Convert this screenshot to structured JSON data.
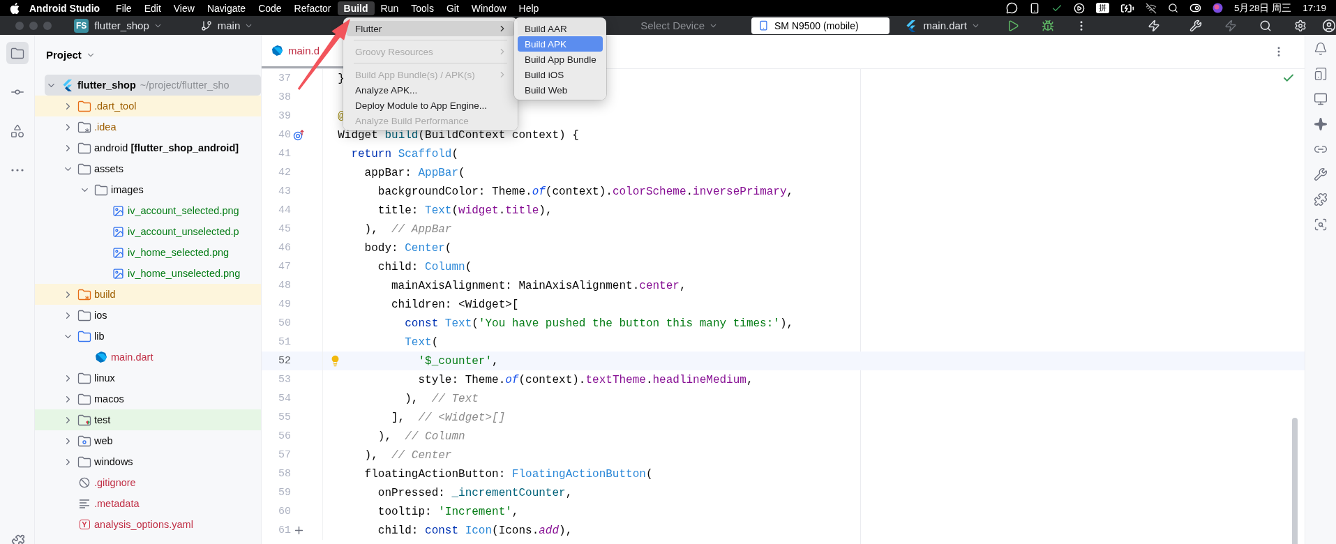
{
  "menu_bar": {
    "app_name": "Android Studio",
    "items": [
      {
        "label": "File",
        "selected": false
      },
      {
        "label": "Edit",
        "selected": false
      },
      {
        "label": "View",
        "selected": false
      },
      {
        "label": "Navigate",
        "selected": false
      },
      {
        "label": "Code",
        "selected": false
      },
      {
        "label": "Refactor",
        "selected": false
      },
      {
        "label": "Build",
        "selected": true
      },
      {
        "label": "Run",
        "selected": false
      },
      {
        "label": "Tools",
        "selected": false
      },
      {
        "label": "Git",
        "selected": false
      },
      {
        "label": "Window",
        "selected": false
      },
      {
        "label": "Help",
        "selected": false
      }
    ],
    "input_method": "拼",
    "date": "5月28日 周三",
    "time": "17:19"
  },
  "toolbar": {
    "project_badge": "FS",
    "project": "flutter_shop",
    "branch": "main",
    "device_selector": "Select Device",
    "device": "SM N9500 (mobile)",
    "run_config": "main.dart"
  },
  "left_strip": [
    {
      "kind": "project",
      "selected": true
    },
    {
      "kind": "commit",
      "selected": false
    },
    {
      "kind": "structure",
      "selected": false
    },
    {
      "kind": "more",
      "selected": false
    }
  ],
  "project_panel": {
    "title": "Project",
    "tree": [
      {
        "name": "flutter_shop",
        "hint": "~/project/flutter_sho",
        "kind": "flutter",
        "color": "#080808",
        "selected": true,
        "expanded": true,
        "children": [
          {
            "name": ".dart_tool",
            "kind": "excluded-folder",
            "color": "#9e5e00",
            "selected": false,
            "expanded": false
          },
          {
            "name": ".idea",
            "kind": "config-folder",
            "color": "#9e5e00",
            "selected": false,
            "expanded": false
          },
          {
            "name": "android **[flutter_shop_android]**",
            "kind": "folder",
            "color": "#080808",
            "selected": false,
            "expanded": false
          },
          {
            "name": "assets",
            "kind": "folder",
            "color": "#080808",
            "selected": false,
            "expanded": true,
            "children": [
              {
                "name": "images",
                "kind": "folder",
                "color": "#080808",
                "selected": false,
                "expanded": true,
                "children": [
                  {
                    "name": "iv_account_selected.png",
                    "kind": "image",
                    "color": "#067d17",
                    "selected": false
                  },
                  {
                    "name": "iv_account_unselected.p",
                    "kind": "image",
                    "color": "#067d17",
                    "selected": false
                  },
                  {
                    "name": "iv_home_selected.png",
                    "kind": "image",
                    "color": "#067d17",
                    "selected": false
                  },
                  {
                    "name": "iv_home_unselected.png",
                    "kind": "image",
                    "color": "#067d17",
                    "selected": false
                  }
                ]
              }
            ]
          },
          {
            "name": "build",
            "kind": "excluded-config-folder",
            "color": "#9e5e00",
            "selected": false,
            "expanded": false
          },
          {
            "name": "ios",
            "kind": "folder",
            "color": "#080808",
            "selected": false,
            "expanded": false
          },
          {
            "name": "lib",
            "kind": "source-folder",
            "color": "#080808",
            "selected": false,
            "expanded": true,
            "children": [
              {
                "name": "main.dart",
                "kind": "dart",
                "color": "#c02f45",
                "selected": false
              }
            ]
          },
          {
            "name": "linux",
            "kind": "folder",
            "color": "#080808",
            "selected": false,
            "expanded": false
          },
          {
            "name": "macos",
            "kind": "folder",
            "color": "#080808",
            "selected": false,
            "expanded": false
          },
          {
            "name": "test",
            "kind": "test-folder",
            "color": "#080808",
            "selected": false,
            "expanded": false
          },
          {
            "name": "web",
            "kind": "web-folder",
            "color": "#080808",
            "selected": false,
            "expanded": false
          },
          {
            "name": "windows",
            "kind": "folder",
            "color": "#080808",
            "selected": false,
            "expanded": false
          },
          {
            "name": ".gitignore",
            "kind": "ignore",
            "color": "#c02f45",
            "selected": false
          },
          {
            "name": ".metadata",
            "kind": "lines",
            "color": "#c02f45",
            "selected": false
          },
          {
            "name": "analysis_options.yaml",
            "kind": "yaml",
            "badge": "Y",
            "color": "#c02f45",
            "selected": false
          }
        ]
      }
    ]
  },
  "editor": {
    "tab": {
      "label": "main.d",
      "selected": true
    },
    "lines": [
      {
        "number": "37",
        "current": false,
        "tokens": [
          {
            "text": "  }",
            "kind": "plain"
          }
        ]
      },
      {
        "number": "38",
        "current": false
      },
      {
        "number": "39",
        "current": false,
        "tokens": [
          {
            "text": "  @",
            "kind": "annotation"
          }
        ]
      },
      {
        "number": "40",
        "current": false,
        "kind": "override",
        "tokens": [
          {
            "text": "  Widget ",
            "kind": "plain"
          },
          {
            "text": "build",
            "kind": "method"
          },
          {
            "text": "(BuildContext context) {",
            "kind": "plain"
          }
        ]
      },
      {
        "number": "41",
        "current": false,
        "tokens": [
          {
            "text": "    return ",
            "kind": "keyword"
          },
          {
            "text": "Scaffold",
            "kind": "type"
          },
          {
            "text": "(",
            "kind": "plain"
          }
        ]
      },
      {
        "number": "42",
        "current": false,
        "tokens": [
          {
            "text": "      appBar: ",
            "kind": "plain"
          },
          {
            "text": "AppBar",
            "kind": "type"
          },
          {
            "text": "(",
            "kind": "plain"
          }
        ]
      },
      {
        "number": "43",
        "current": false,
        "tokens": [
          {
            "text": "        backgroundColor: Theme.",
            "kind": "plain"
          },
          {
            "text": "of",
            "kind": "static"
          },
          {
            "text": "(context).",
            "kind": "plain"
          },
          {
            "text": "colorScheme",
            "kind": "field"
          },
          {
            "text": ".",
            "kind": "plain"
          },
          {
            "text": "inversePrimary",
            "kind": "field"
          },
          {
            "text": ",",
            "kind": "plain"
          }
        ]
      },
      {
        "number": "44",
        "current": false,
        "tokens": [
          {
            "text": "        title: ",
            "kind": "plain"
          },
          {
            "text": "Text",
            "kind": "type"
          },
          {
            "text": "(",
            "kind": "plain"
          },
          {
            "text": "widget",
            "kind": "field"
          },
          {
            "text": ".",
            "kind": "plain"
          },
          {
            "text": "title",
            "kind": "field"
          },
          {
            "text": "),",
            "kind": "plain"
          }
        ]
      },
      {
        "number": "45",
        "current": false,
        "tokens": [
          {
            "text": "      ),  ",
            "kind": "plain"
          },
          {
            "text": "// AppBar",
            "kind": "comment"
          }
        ]
      },
      {
        "number": "46",
        "current": false,
        "tokens": [
          {
            "text": "      body: ",
            "kind": "plain"
          },
          {
            "text": "Center",
            "kind": "type"
          },
          {
            "text": "(",
            "kind": "plain"
          }
        ]
      },
      {
        "number": "47",
        "current": false,
        "tokens": [
          {
            "text": "        child: ",
            "kind": "plain"
          },
          {
            "text": "Column",
            "kind": "type"
          },
          {
            "text": "(",
            "kind": "plain"
          }
        ]
      },
      {
        "number": "48",
        "current": false,
        "tokens": [
          {
            "text": "          mainAxisAlignment: MainAxisAlignment.",
            "kind": "plain"
          },
          {
            "text": "center",
            "kind": "field"
          },
          {
            "text": ",",
            "kind": "plain"
          }
        ]
      },
      {
        "number": "49",
        "current": false,
        "tokens": [
          {
            "text": "          children: <Widget>[",
            "kind": "plain"
          }
        ]
      },
      {
        "number": "50",
        "current": false,
        "tokens": [
          {
            "text": "            const ",
            "kind": "keyword"
          },
          {
            "text": "Text",
            "kind": "type"
          },
          {
            "text": "(",
            "kind": "plain"
          },
          {
            "text": "'You have pushed the button this many times:'",
            "kind": "string"
          },
          {
            "text": "),",
            "kind": "plain"
          }
        ]
      },
      {
        "number": "51",
        "current": false,
        "tokens": [
          {
            "text": "            Text",
            "kind": "type"
          },
          {
            "text": "(",
            "kind": "plain"
          }
        ]
      },
      {
        "number": "52",
        "current": true,
        "kind": "bulb",
        "tokens": [
          {
            "text": "              '$_counter'",
            "kind": "string"
          },
          {
            "text": ",",
            "kind": "plain"
          }
        ]
      },
      {
        "number": "53",
        "current": false,
        "tokens": [
          {
            "text": "              style: Theme.",
            "kind": "plain"
          },
          {
            "text": "of",
            "kind": "static"
          },
          {
            "text": "(context).",
            "kind": "plain"
          },
          {
            "text": "textTheme",
            "kind": "field"
          },
          {
            "text": ".",
            "kind": "plain"
          },
          {
            "text": "headlineMedium",
            "kind": "field"
          },
          {
            "text": ",",
            "kind": "plain"
          }
        ]
      },
      {
        "number": "54",
        "current": false,
        "tokens": [
          {
            "text": "            ),  ",
            "kind": "plain"
          },
          {
            "text": "// Text",
            "kind": "comment"
          }
        ]
      },
      {
        "number": "55",
        "current": false,
        "tokens": [
          {
            "text": "          ],  ",
            "kind": "plain"
          },
          {
            "text": "// <Widget>[]",
            "kind": "comment"
          }
        ]
      },
      {
        "number": "56",
        "current": false,
        "tokens": [
          {
            "text": "        ),  ",
            "kind": "plain"
          },
          {
            "text": "// Column",
            "kind": "comment"
          }
        ]
      },
      {
        "number": "57",
        "current": false,
        "tokens": [
          {
            "text": "      ),  ",
            "kind": "plain"
          },
          {
            "text": "// Center",
            "kind": "comment"
          }
        ]
      },
      {
        "number": "58",
        "current": false,
        "tokens": [
          {
            "text": "      floatingActionButton: ",
            "kind": "plain"
          },
          {
            "text": "FloatingActionButton",
            "kind": "type"
          },
          {
            "text": "(",
            "kind": "plain"
          }
        ]
      },
      {
        "number": "59",
        "current": false,
        "tokens": [
          {
            "text": "        onPressed: ",
            "kind": "plain"
          },
          {
            "text": "_incrementCounter",
            "kind": "method"
          },
          {
            "text": ",",
            "kind": "plain"
          }
        ]
      },
      {
        "number": "60",
        "current": false,
        "tokens": [
          {
            "text": "        tooltip: ",
            "kind": "plain"
          },
          {
            "text": "'Increment'",
            "kind": "string"
          },
          {
            "text": ",",
            "kind": "plain"
          }
        ]
      },
      {
        "number": "61",
        "current": false,
        "kind": "add",
        "tokens": [
          {
            "text": "        child: ",
            "kind": "plain"
          },
          {
            "text": "const ",
            "kind": "keyword"
          },
          {
            "text": "Icon",
            "kind": "type"
          },
          {
            "text": "(Icons.",
            "kind": "plain"
          },
          {
            "text": "add",
            "kind": "field-italic"
          },
          {
            "text": "),",
            "kind": "plain"
          }
        ]
      }
    ]
  },
  "build_menu": {
    "items": [
      {
        "kind": "submenu",
        "label": "Flutter",
        "disabled": false,
        "selected": true
      },
      {
        "kind": "separator"
      },
      {
        "kind": "submenu",
        "label": "Groovy Resources",
        "disabled": true,
        "selected": false
      },
      {
        "kind": "separator"
      },
      {
        "kind": "submenu",
        "label": "Build App Bundle(s) / APK(s)",
        "disabled": true,
        "selected": false
      },
      {
        "kind": "item",
        "label": "Analyze APK...",
        "disabled": false,
        "selected": false
      },
      {
        "kind": "item",
        "label": "Deploy Module to App Engine...",
        "disabled": false,
        "selected": false
      },
      {
        "kind": "item",
        "label": "Analyze Build Performance",
        "disabled": true,
        "selected": false
      }
    ]
  },
  "flutter_submenu": {
    "items": [
      {
        "label": "Build AAR",
        "selected": false
      },
      {
        "label": "Build APK",
        "selected": true
      },
      {
        "label": "Build App Bundle",
        "selected": false
      },
      {
        "label": "Build iOS",
        "selected": false
      },
      {
        "label": "Build Web",
        "selected": false
      }
    ]
  },
  "right_strip": [
    {
      "kind": "notifications"
    },
    {
      "kind": "device-manager"
    },
    {
      "kind": "device-mirror"
    },
    {
      "kind": "gemini"
    },
    {
      "kind": "flutter-deep-links"
    },
    {
      "kind": "flutter-devtools"
    },
    {
      "kind": "flutter-inspector"
    },
    {
      "kind": "flutter-search"
    }
  ]
}
